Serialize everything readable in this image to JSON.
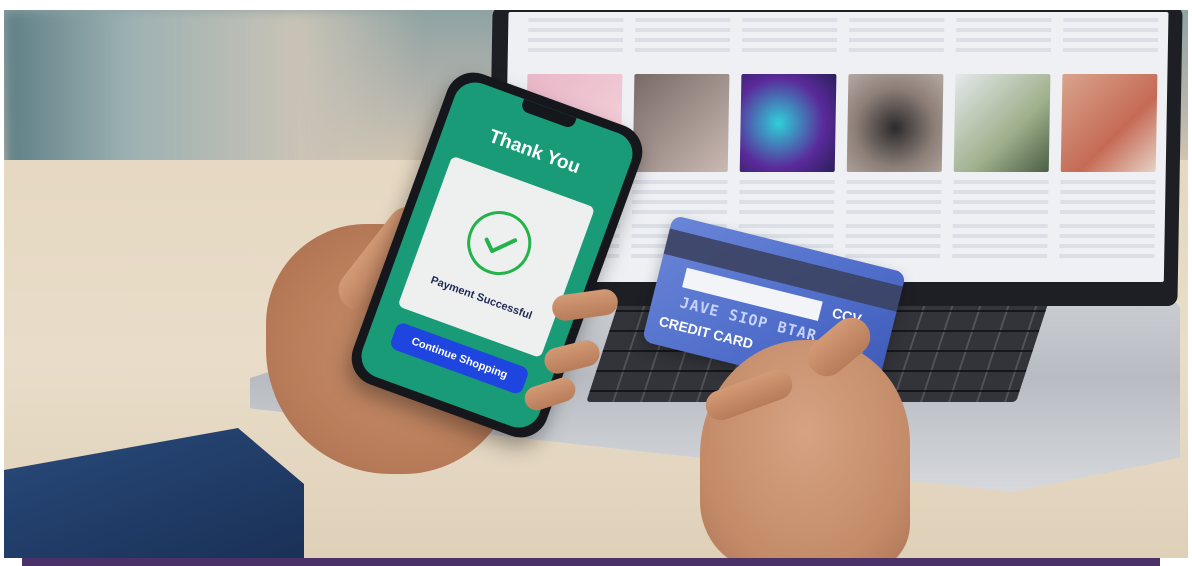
{
  "phone": {
    "title": "Thank You",
    "status": "Payment Successful",
    "button_label": "Continue Shopping",
    "check_icon": "check-circle-icon",
    "colors": {
      "screen": "#1a9b78",
      "button": "#1e45e0",
      "check": "#22b34a"
    }
  },
  "credit_card": {
    "label": "CREDIT CARD",
    "ccv": "CCV",
    "number": "JAVE SIOP BTAR VESL"
  },
  "colors": {
    "bottom_bar": "#4a3268"
  }
}
